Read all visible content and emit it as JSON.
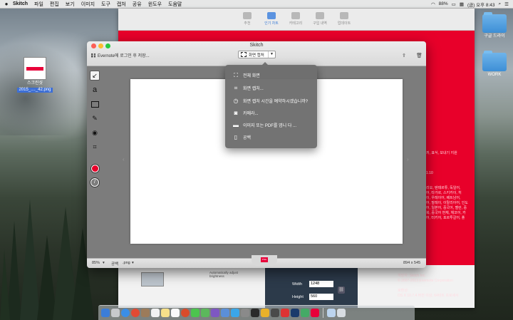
{
  "menubar": {
    "apple": "",
    "items": [
      "Skitch",
      "파일",
      "편집",
      "보기",
      "이미지",
      "도구",
      "캡처",
      "공유",
      "윈도우",
      "도움말"
    ],
    "status": {
      "battery": "88%",
      "clock": "(금) 오후 8:43"
    }
  },
  "desktop": {
    "file_icon": {
      "label1": "스크린샷",
      "label2": "2015_...._42.png"
    },
    "folder1": "구글 드라이",
    "folder2": "WORK"
  },
  "bg_app": {
    "tabs": [
      "추천",
      "인기 차트",
      "카테고리",
      "구입 내역",
      "업데이트"
    ],
    "right_text": [
      "끼, 표식, 보내기 지원",
      "",
      "",
      "",
      "1.10",
      "",
      "",
      "리오, 텐테르튜, 독일어,",
      "어, 타가르, 스키카이, 히",
      "이, 우레이어, 베트남어,",
      "어, 말레이, 이탈리아어, 인도",
      "어, 일본어, 중국어, 벨란, 중",
      "복, 중국어 번체, 체코어, 카",
      "어, 터키어, 포르투갈어, 폴"
    ],
    "width_label": "Width",
    "width_value": "1248",
    "height_label": "Height",
    "height_value": "560",
    "adjust_text": "Automatically adjust brightness",
    "info": [
      "개발자: Skitch Inc.",
      "© 2007-2013 Evernote Corporation",
      "",
      "호환성:",
      "OS X 10.7.4 버전 이상, 64비트 프로세서"
    ]
  },
  "skitch": {
    "title": "Skitch",
    "evernote_login": "Evernote에 로그인 후 저장...",
    "capture_button": "화면 캡처",
    "status_zoom": "85%",
    "status_name": "공백",
    "status_ext": ".png",
    "status_size": "894 x 545"
  },
  "capture_menu": [
    {
      "icon": "fullscreen-icon",
      "label": "전체 화면"
    },
    {
      "icon": "crop-icon",
      "label": "화면 캡처..."
    },
    {
      "icon": "timer-icon",
      "label": "화면 캡처 시간을 예약하시겠습니까?"
    },
    {
      "icon": "camera-icon",
      "label": "카메라..."
    },
    {
      "icon": "folder-icon",
      "label": "이미지 또는 PDF를 엽니 다 ..."
    },
    {
      "icon": "blank-doc-icon",
      "label": "공백"
    }
  ],
  "colors": {
    "accent": "#e8002a",
    "menu_bg": "#6e6e6e",
    "brand_red": "#e8003a"
  }
}
